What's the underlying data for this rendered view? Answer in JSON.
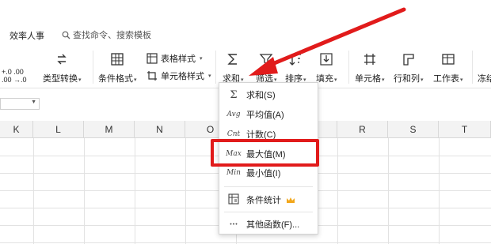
{
  "menubar": {
    "tab_efficiency": "效率人事",
    "search_placeholder": "查找命令、搜索模板"
  },
  "ribbon": {
    "type_convert": "类型转换",
    "cond_format": "条件格式",
    "table_style": "表格样式",
    "cell_style": "单元格样式",
    "sum": "求和",
    "filter": "筛选",
    "sort": "排序",
    "fill": "填充",
    "cell": "单元格",
    "row_col": "行和列",
    "sheet": "工作表",
    "freeze": "冻结",
    "dec_inc": "+.0 .00",
    "dec_dec": ".00 →.0"
  },
  "columns": [
    "K",
    "L",
    "M",
    "N",
    "O",
    "R",
    "S",
    "T"
  ],
  "dropdown": {
    "items": [
      {
        "icon": "Σ",
        "label": "求和(S)"
      },
      {
        "icon": "Avg",
        "label": "平均值(A)"
      },
      {
        "icon": "Cnt",
        "label": "计数(C)"
      },
      {
        "icon": "Max",
        "label": "最大值(M)"
      },
      {
        "icon": "Min",
        "label": "最小值(I)"
      },
      {
        "icon": "",
        "label": "条件统计"
      },
      {
        "icon": "···",
        "label": "其他函数(F)..."
      }
    ]
  },
  "colors": {
    "accent_red": "#e11b1b",
    "crown": "#f2a71b"
  }
}
